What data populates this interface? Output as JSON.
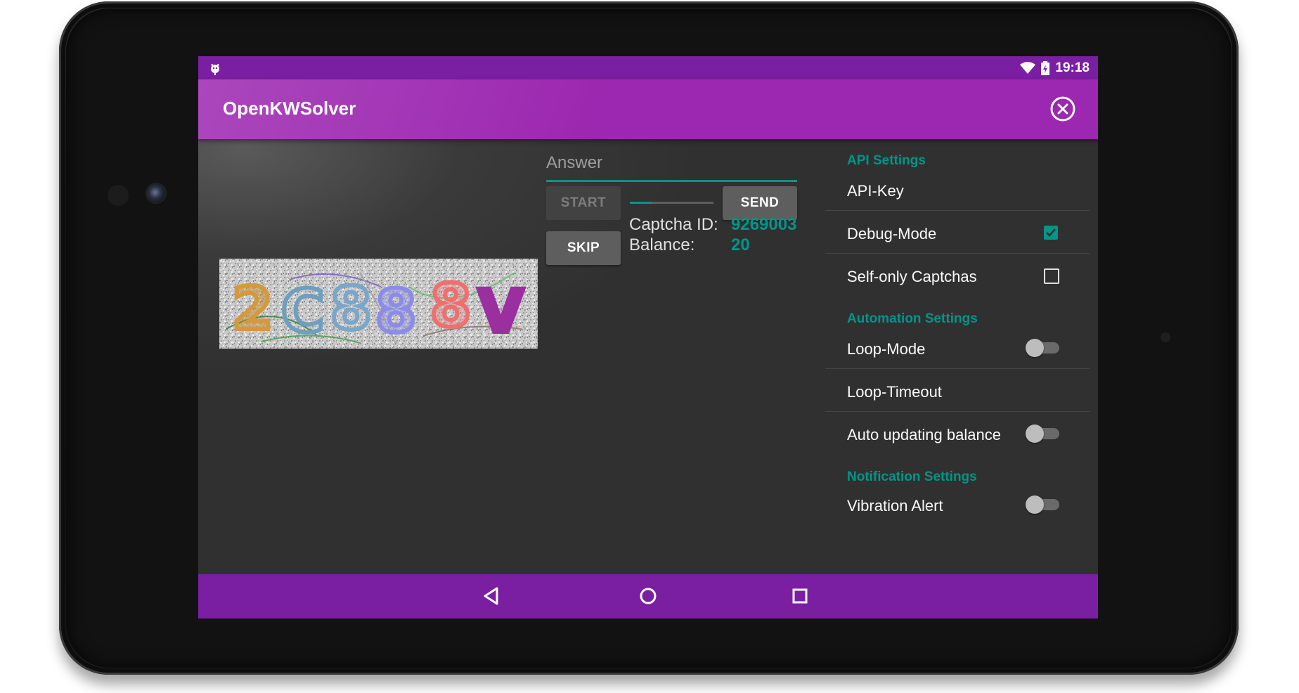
{
  "status_bar": {
    "time": "19:18"
  },
  "app_bar": {
    "title": "OpenKWSolver"
  },
  "solver": {
    "captcha_text": "2C88 8V",
    "answer_placeholder": "Answer",
    "start_label": "START",
    "send_label": "SEND",
    "skip_label": "SKIP",
    "progress_fraction": 0.27,
    "captcha_id_label": "Captcha ID:",
    "captcha_id_value": "9269003",
    "balance_label": "Balance:",
    "balance_value": "20"
  },
  "settings": {
    "api_category": "API Settings",
    "api_key": "API-Key",
    "debug_mode": "Debug-Mode",
    "debug_mode_checked": true,
    "self_only": "Self-only Captchas",
    "self_only_checked": false,
    "automation_category": "Automation Settings",
    "loop_mode": "Loop-Mode",
    "loop_mode_on": false,
    "loop_timeout": "Loop-Timeout",
    "auto_balance": "Auto updating balance",
    "auto_balance_on": false,
    "notification_category": "Notification Settings",
    "vibration_alert": "Vibration Alert",
    "vibration_alert_on": false
  },
  "colors": {
    "primary": "#9c27b0",
    "primary_dark": "#7b1fa2",
    "accent": "#009688",
    "background": "#303030"
  }
}
